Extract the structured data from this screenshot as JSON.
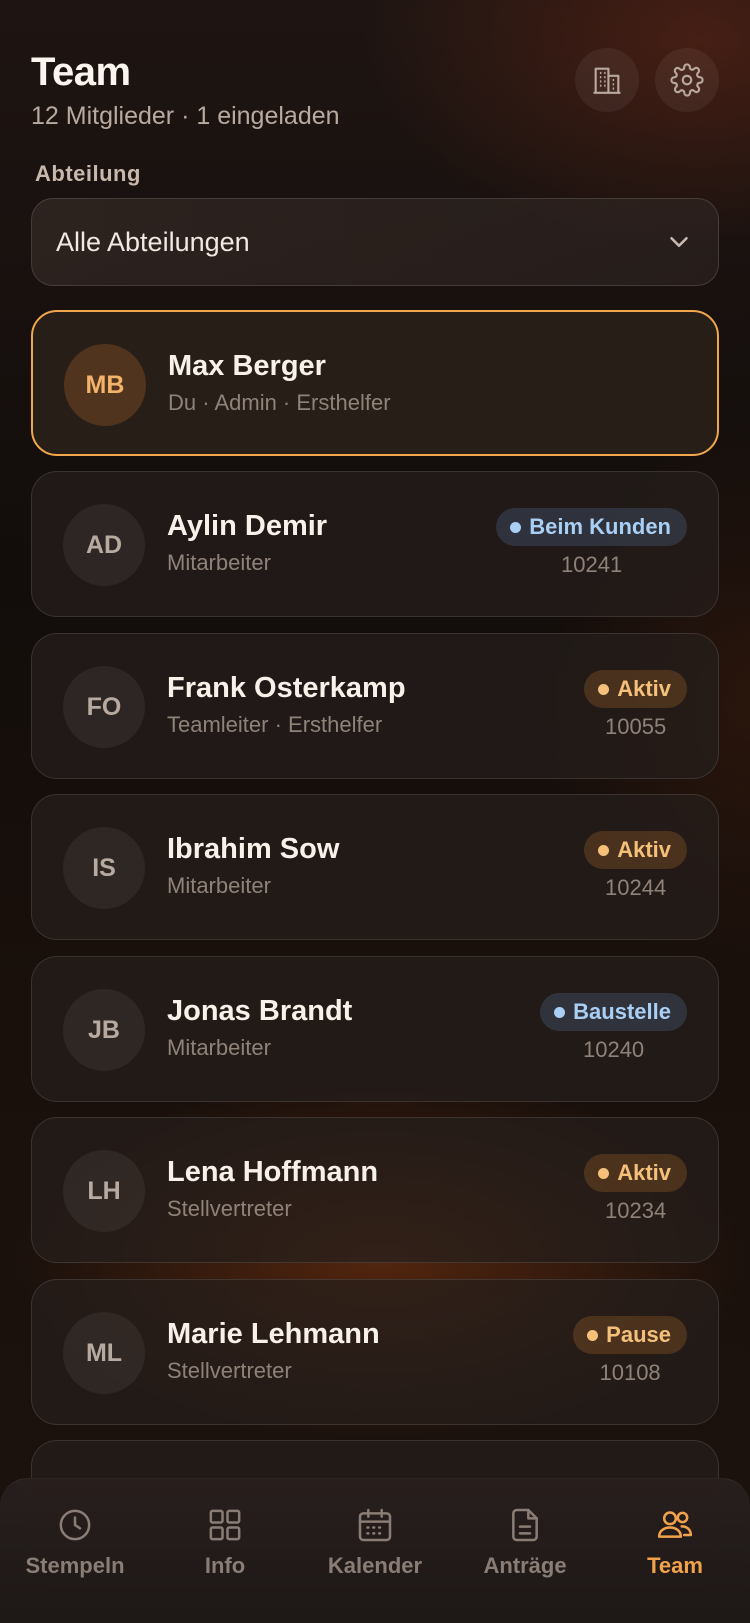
{
  "header": {
    "title": "Team",
    "subtitle": "12 Mitglieder · 1 eingeladen",
    "icons": [
      "building-icon",
      "gear-icon"
    ]
  },
  "filter": {
    "label": "Abteilung",
    "selected": "Alle Abteilungen"
  },
  "members": [
    {
      "initials": "MB",
      "name": "Max Berger",
      "role": "Du · Admin · Ersthelfer",
      "status": "",
      "status_color": "",
      "id": ""
    },
    {
      "initials": "AD",
      "name": "Aylin Demir",
      "role": "Mitarbeiter",
      "status": "Beim Kunden",
      "status_color": "#a9cff5",
      "id": "10241"
    },
    {
      "initials": "FO",
      "name": "Frank Osterkamp",
      "role": "Teamleiter · Ersthelfer",
      "status": "Aktiv",
      "status_color": "#f5c17a",
      "id": "10055"
    },
    {
      "initials": "IS",
      "name": "Ibrahim Sow",
      "role": "Mitarbeiter",
      "status": "Aktiv",
      "status_color": "#f5c17a",
      "id": "10244"
    },
    {
      "initials": "JB",
      "name": "Jonas Brandt",
      "role": "Mitarbeiter",
      "status": "Baustelle",
      "status_color": "#a9cff5",
      "id": "10240"
    },
    {
      "initials": "LH",
      "name": "Lena Hoffmann",
      "role": "Stellvertreter",
      "status": "Aktiv",
      "status_color": "#f5c17a",
      "id": "10234"
    },
    {
      "initials": "ML",
      "name": "Marie Lehmann",
      "role": "Stellvertreter",
      "status": "Pause",
      "status_color": "#f5c17a",
      "id": "10108"
    }
  ],
  "tabbar": {
    "items": [
      {
        "label": "Stempeln",
        "icon": "clock-icon"
      },
      {
        "label": "Info",
        "icon": "grid-icon"
      },
      {
        "label": "Kalender",
        "icon": "calendar-icon"
      },
      {
        "label": "Anträge",
        "icon": "document-icon"
      },
      {
        "label": "Team",
        "icon": "team-icon"
      }
    ],
    "active": "Team"
  },
  "colors": {
    "accent": "#f2a24a",
    "status_orange": "#f5c17a",
    "status_blue": "#a9cff5"
  }
}
